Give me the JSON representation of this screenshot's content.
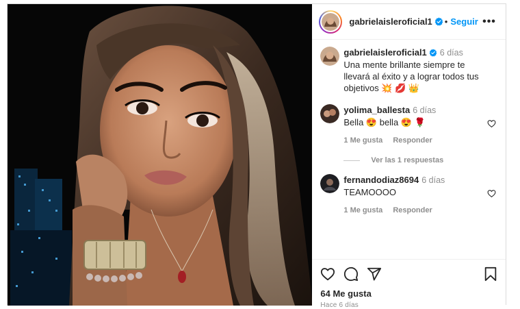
{
  "post": {
    "author": "gabrielaisleroficial1",
    "follow_label": "Seguir",
    "separator": "•",
    "more_label": "•••"
  },
  "caption": {
    "username": "gabrielaisleroficial1",
    "time": "6 días",
    "text": "Una mente brillante siempre te llevará al éxito y a lograr todos tus objetivos 💥 💋 👑"
  },
  "comments": [
    {
      "username": "yolima_ballesta",
      "time": "6 días",
      "text": "Bella 😍 bella 😍 🌹",
      "likes": "1 Me gusta",
      "reply": "Responder",
      "view_replies": "Ver las 1 respuestas"
    },
    {
      "username": "fernandodiaz8694",
      "time": "6 días",
      "text": "TEAMOOOO",
      "likes": "1 Me gusta",
      "reply": "Responder"
    }
  ],
  "footer": {
    "likes": "64 Me gusta",
    "timestamp": "Hace 6 días"
  },
  "colors": {
    "link": "#0095f6",
    "muted": "#8e8e8e",
    "text": "#262626",
    "verified": "#0095f6"
  },
  "icons": [
    "verified-badge-icon",
    "more-options-icon",
    "heart-icon",
    "comment-icon",
    "share-icon",
    "bookmark-icon"
  ]
}
